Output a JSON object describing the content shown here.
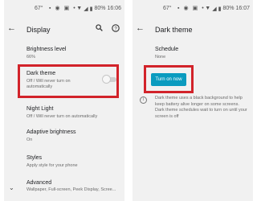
{
  "left": {
    "status": {
      "left_text": "67°",
      "time": "16:06",
      "battery": "80%"
    },
    "appbar": {
      "title": "Display"
    },
    "rows": [
      {
        "title": "Brightness level",
        "subtitle": "66%"
      },
      {
        "title": "Dark theme",
        "subtitle": "Off / Will never turn on automatically"
      },
      {
        "title": "Night Light",
        "subtitle": "Off / Will never turn on automatically"
      },
      {
        "title": "Adaptive brightness",
        "subtitle": "On"
      },
      {
        "title": "Styles",
        "subtitle": "Apply style for your phone"
      },
      {
        "title": "Advanced",
        "subtitle": "Wallpaper, Full-screen, Peek Display, Scree..."
      }
    ],
    "dark_theme_toggle": "off"
  },
  "right": {
    "status": {
      "left_text": "67°",
      "time": "16:07",
      "battery": "80%"
    },
    "appbar": {
      "title": "Dark theme"
    },
    "schedule": {
      "title": "Schedule",
      "subtitle": "None"
    },
    "button_label": "Turn on now",
    "info_text": "Dark theme uses a black background to help keep battery alive longer on some screens. Dark theme schedules wait to turn on until your screen is off"
  },
  "icons": {
    "back": "back-arrow-icon",
    "search": "search-icon",
    "help": "help-icon",
    "wifi": "wifi-icon",
    "battery": "battery-icon",
    "chevron": "chevron-down-icon",
    "info": "info-icon"
  },
  "colors": {
    "highlight": "#d2232a",
    "accent_button": "#0a9bbf",
    "background": "#f1f1f1"
  }
}
